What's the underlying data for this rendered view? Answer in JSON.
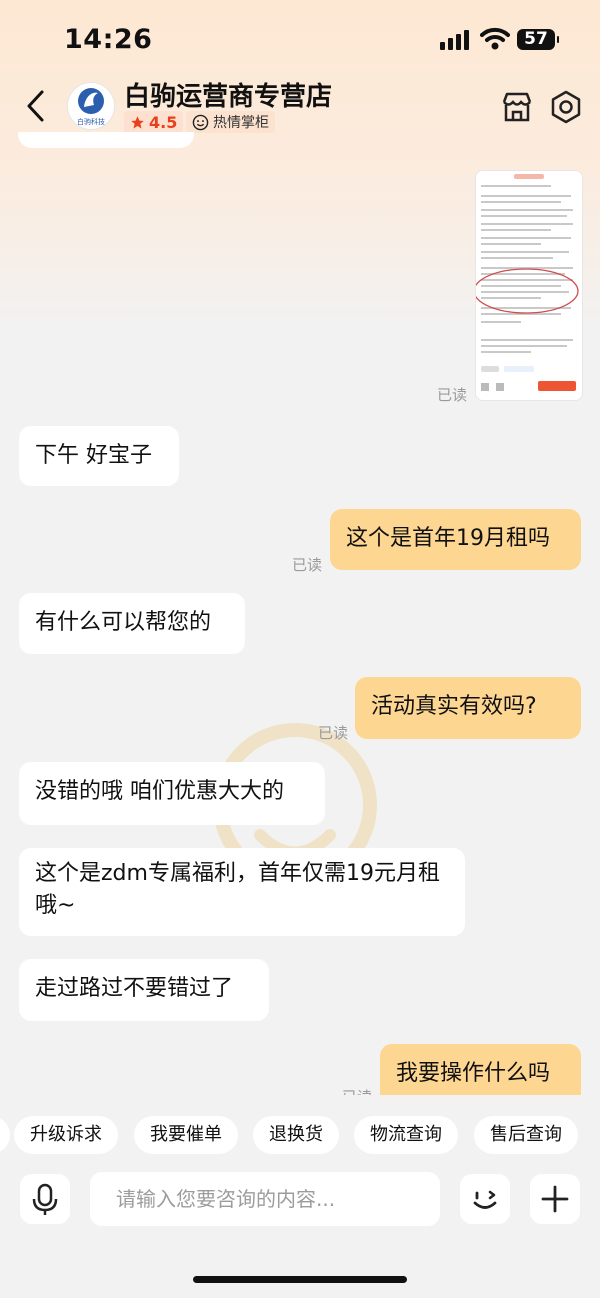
{
  "status_bar": {
    "time": "14:26",
    "battery": "57"
  },
  "header": {
    "shop_name": "白驹运营商专营店",
    "rating": "4.5",
    "badge": "热情掌柜",
    "logo_text": "白驹科技"
  },
  "chat": {
    "screenshot_read": "已读",
    "messages": [
      {
        "side": "in",
        "text": "下午 好宝子"
      },
      {
        "side": "out",
        "text": "这个是首年19月租吗",
        "status": "已读"
      },
      {
        "side": "in",
        "text": "有什么可以帮您的"
      },
      {
        "side": "out",
        "text": "活动真实有效吗?",
        "status": "已读"
      },
      {
        "side": "in",
        "text": "没错的哦 咱们优惠大大的"
      },
      {
        "side": "in",
        "text": "这个是zdm专属福利，首年仅需19元月租哦~"
      },
      {
        "side": "in",
        "text": "走过路过不要错过了"
      },
      {
        "side": "out",
        "text": "我要操作什么吗",
        "status": "已读"
      }
    ]
  },
  "quick_actions": [
    "升级诉求",
    "我要催单",
    "退换货",
    "物流查询",
    "售后查询"
  ],
  "input": {
    "placeholder": "请输入您要咨询的内容..."
  },
  "colors": {
    "accent": "#fdd692",
    "rating_red": "#e8401c"
  }
}
